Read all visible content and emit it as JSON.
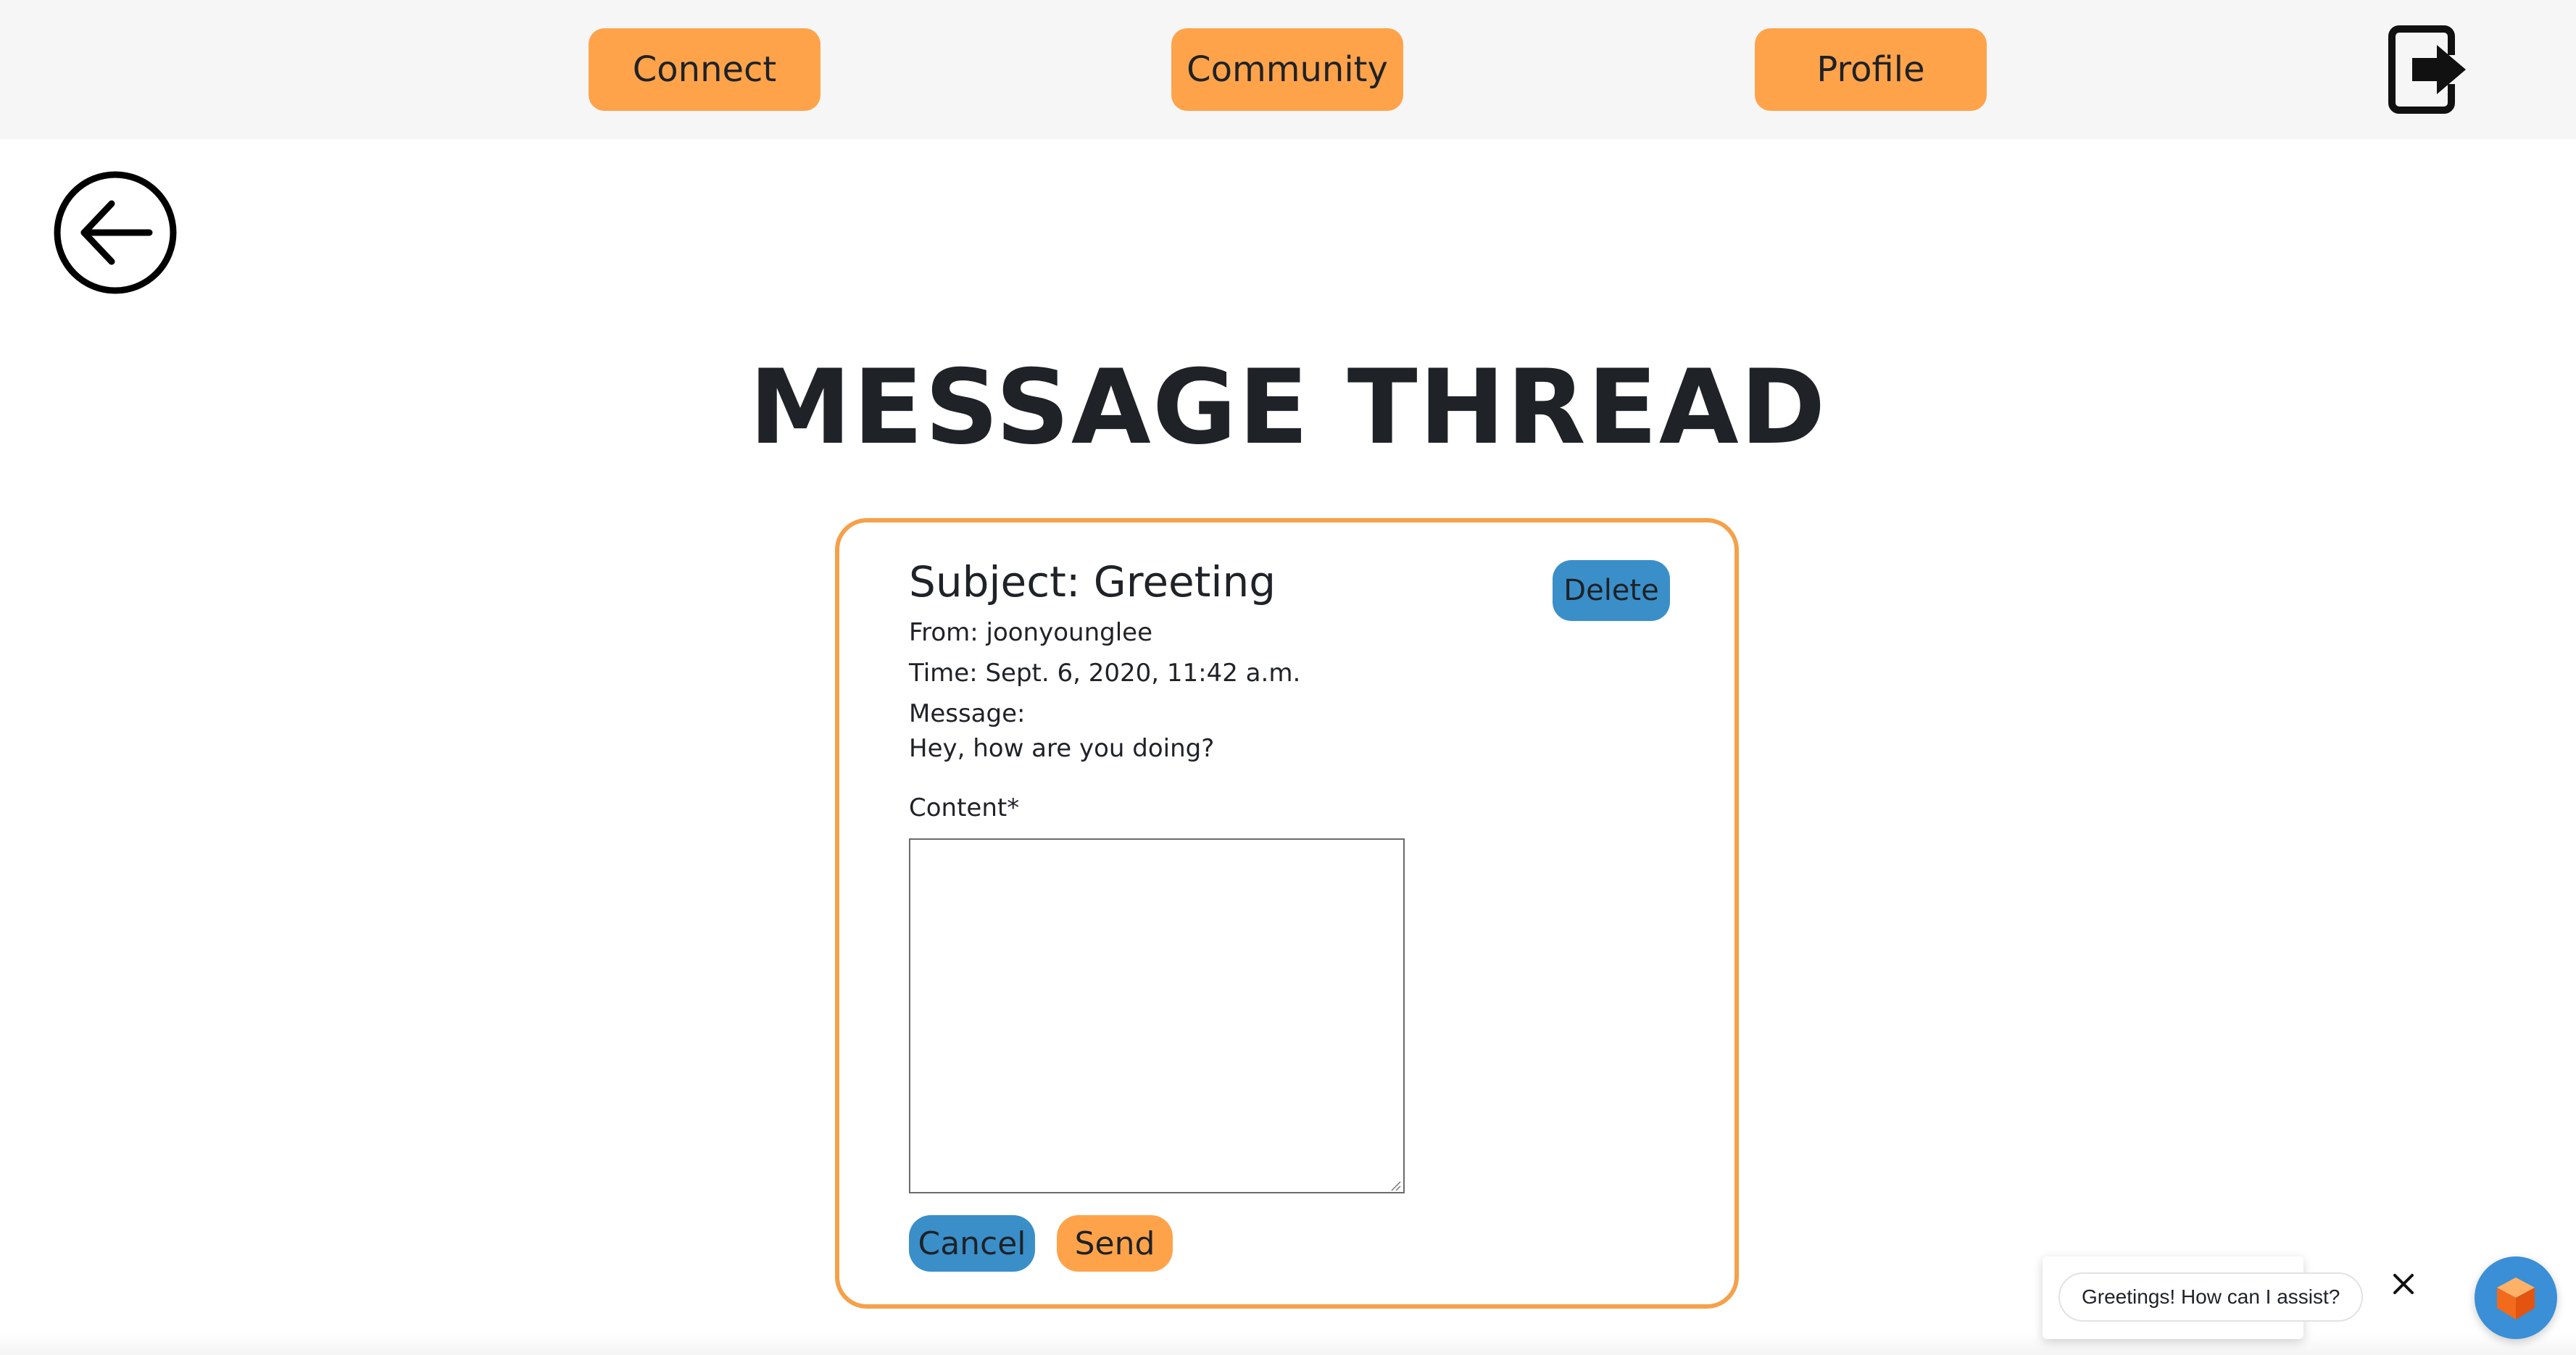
{
  "nav": {
    "connect_label": "Connect",
    "community_label": "Community",
    "profile_label": "Profile",
    "logout_icon": "logout-icon"
  },
  "back_icon": "arrow-left-circle-icon",
  "page_title": "MESSAGE THREAD",
  "thread": {
    "subject": "Subject: Greeting",
    "delete_label": "Delete",
    "from": "From: joonyounglee",
    "time": "Time: Sept. 6, 2020, 11:42 a.m.",
    "message_label": "Message:",
    "message_body": "Hey, how are you doing?",
    "content_label": "Content*",
    "content_value": "",
    "cancel_label": "Cancel",
    "send_label": "Send"
  },
  "chat_widget": {
    "greeting": "Greetings! How can I assist?",
    "close_icon": "close-icon",
    "launcher_icon": "cube-icon"
  },
  "colors": {
    "accent_orange": "#ffa34b",
    "accent_blue": "#3a8fc9",
    "card_border": "#f5a04a",
    "text": "#1f2227",
    "topbar_bg": "#f6f6f6"
  }
}
